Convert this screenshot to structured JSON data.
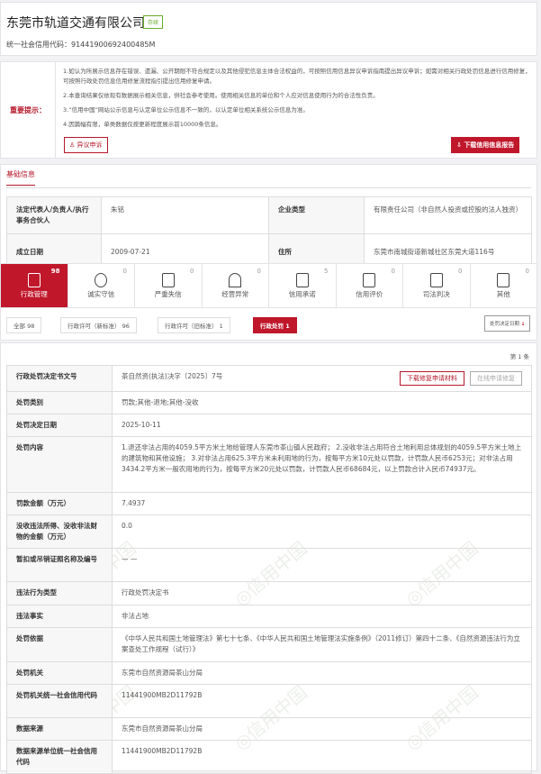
{
  "company": {
    "name": "东莞市轨道交通有限公司",
    "status": "存续",
    "credit_code": "统一社会信用代码：91441900692400485M"
  },
  "notice": {
    "label": "重要提示：",
    "lines": [
      "1.如认为所展示信息存在错误、遗漏、公开期限不符合规定以及其他侵犯信息主体合法权益的，可按照信用信息异议申诉指南提出异议申诉；如需对相关行政处罚信息进行信用修复，可按照行政处罚信息信用修复流程指引提出信用修复申请。",
      "2.本查询结果仅依现有数据展示相关信息，供社会参考使用。使用相关信息的单位和个人应对信息使用行为的合法性负责。",
      "3.“信用中国”网站公示信息与认定单位公示信息不一致的，以认定单位相关系统公示信息为准。",
      "4.因篇幅有限，单类数据仅按更新程度展示前10000条信息。"
    ],
    "appeal_button": "异议申诉",
    "report_button": "下载信用信息报告"
  },
  "basic": {
    "tab": "基础信息",
    "rows": [
      {
        "k1": "法定代表人/负责人/执行事务合伙人",
        "v1": "朱铭",
        "k2": "企业类型",
        "v2": "有限责任公司（非自然人投资或控股的法人独资）"
      },
      {
        "k1": "成立日期",
        "v1": "2009-07-21",
        "k2": "住所",
        "v2": "东莞市南城街道新城社区东莞大道116号"
      }
    ]
  },
  "categories": [
    {
      "name": "行政管理",
      "count": "98"
    },
    {
      "name": "诚实守信",
      "count": "0"
    },
    {
      "name": "严重失信",
      "count": "0"
    },
    {
      "name": "经营异常",
      "count": "0"
    },
    {
      "name": "信用承诺",
      "count": "5"
    },
    {
      "name": "信用评价",
      "count": "0"
    },
    {
      "name": "司法判决",
      "count": "0"
    },
    {
      "name": "其他",
      "count": "0"
    }
  ],
  "filters": [
    {
      "label": "全部  98"
    },
    {
      "label": "行政许可（新标准） 96"
    },
    {
      "label": "行政许可（旧标准） 1"
    },
    {
      "label": "行政处罚  1"
    }
  ],
  "sort_label": "处罚决定日期",
  "item_label": "第 1 条",
  "detail": {
    "download_button": "下载修复申请材料",
    "online_button": "在线申请修复",
    "rows": [
      {
        "k": "行政处罚决定书文号",
        "v": "茶自然资(执法)决字〔2025〕7号"
      },
      {
        "k": "处罚类别",
        "v": "罚款;其他-退地;其他-没收"
      },
      {
        "k": "处罚决定日期",
        "v": "2025-10-11"
      },
      {
        "k": "处罚内容",
        "v": "1.退还非法占用的4059.5平方米土地给管理人东莞市茶山镇人民政府； 2.没收非法占用符合土地利用总体规划的4059.5平方米土地上的建筑物和其他设施； 3.对非法占用625.3平方米未利用地的行为，按每平方米10元处以罚款，计罚款人民币6253元；对非法占用3434.2平方米一般农用地的行为，按每平方米20元处以罚款，计罚款人民币68684元，以上罚款合计人民币74937元。"
      },
      {
        "k": "罚款金额（万元）",
        "v": "7.4937"
      },
      {
        "k": "没收违法所得、没收非法财物的金额（万元）",
        "v": "0.0"
      },
      {
        "k": "暂扣或吊销证照名称及编号",
        "v": "— —"
      },
      {
        "k": "违法行为类型",
        "v": "行政处罚决定书"
      },
      {
        "k": "违法事实",
        "v": "非法占地"
      },
      {
        "k": "处罚依据",
        "v": "《中华人民共和国土地管理法》第七十七条、《中华人民共和国土地管理法实施条例》（2011修订）第四十二条、《自然资源违法行为立案查处工作规程（试行）》"
      },
      {
        "k": "处罚机关",
        "v": "东莞市自然资源局茶山分局"
      },
      {
        "k": "处罚机关统一社会信用代码",
        "v": "11441900MB2D11792B"
      },
      {
        "k": "数据来源",
        "v": "东莞市自然资源局茶山分局"
      },
      {
        "k": "数据来源单位统一社会信用代码",
        "v": "11441900MB2D11792B"
      }
    ]
  },
  "colors": {
    "brand_red": "#c0172b",
    "status_green": "#6aad2a"
  }
}
